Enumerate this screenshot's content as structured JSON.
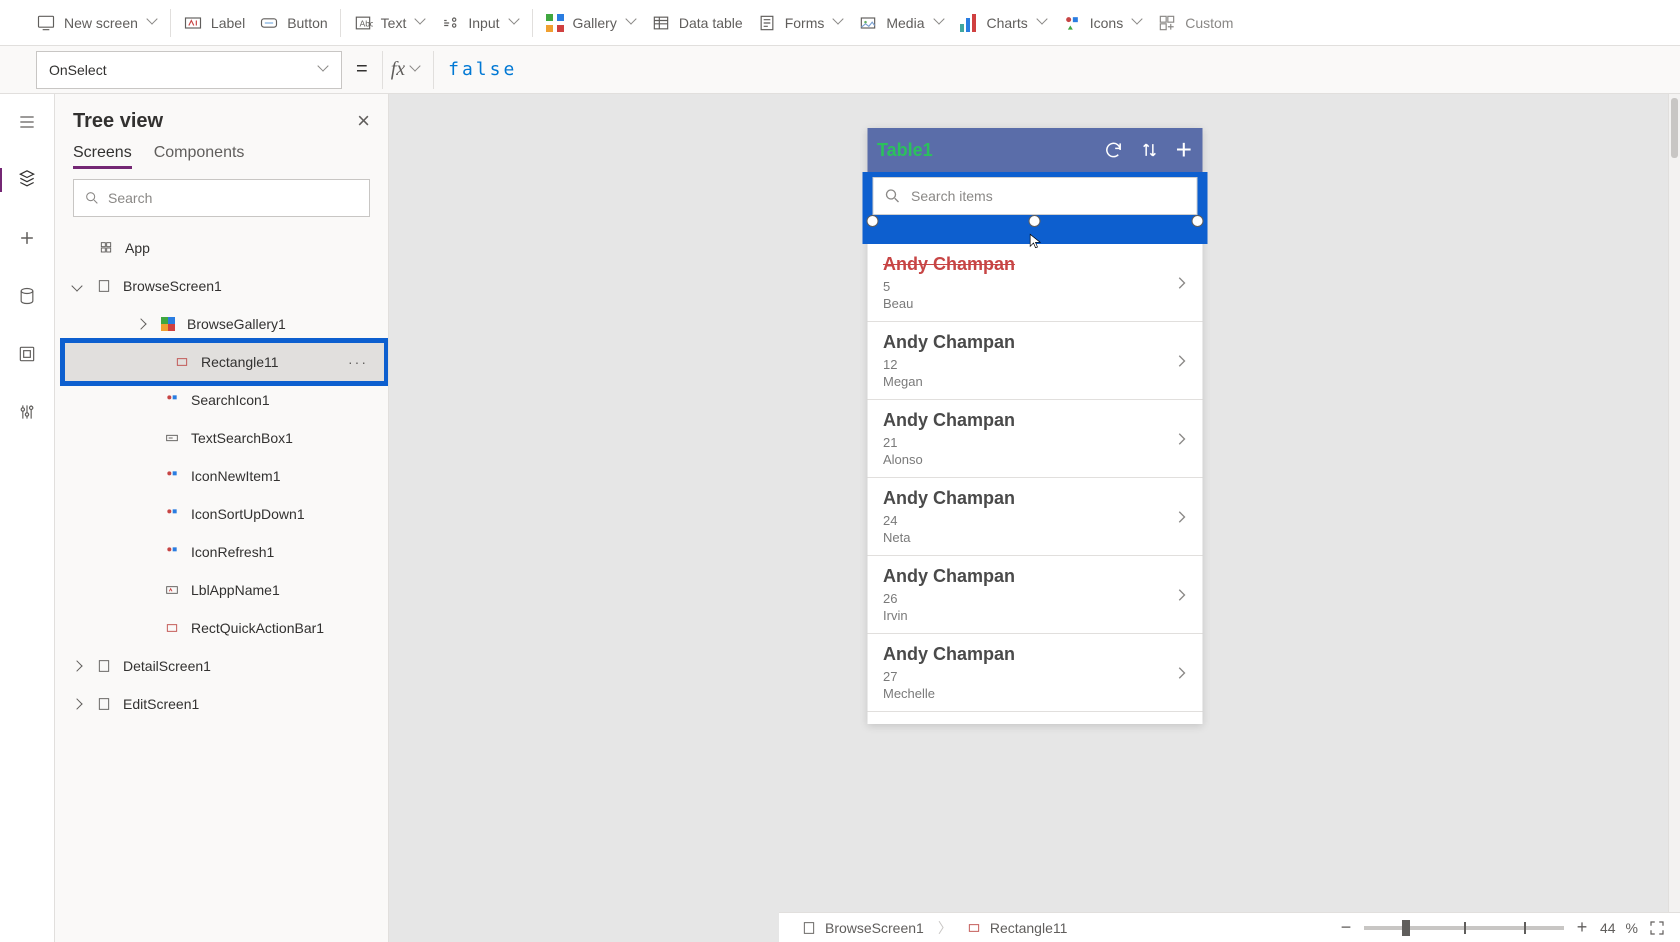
{
  "ribbon": {
    "new_screen": "New screen",
    "label": "Label",
    "button": "Button",
    "text": "Text",
    "input": "Input",
    "gallery": "Gallery",
    "data_table": "Data table",
    "forms": "Forms",
    "media": "Media",
    "charts": "Charts",
    "icons": "Icons",
    "custom": "Custom"
  },
  "formula": {
    "property": "OnSelect",
    "value": "false"
  },
  "tree": {
    "title": "Tree view",
    "tab_screens": "Screens",
    "tab_components": "Components",
    "search_placeholder": "Search",
    "app": "App",
    "browse_screen": "BrowseScreen1",
    "browse_gallery": "BrowseGallery1",
    "rectangle11": "Rectangle11",
    "search_icon1": "SearchIcon1",
    "text_search_box1": "TextSearchBox1",
    "icon_new_item1": "IconNewItem1",
    "icon_sort1": "IconSortUpDown1",
    "icon_refresh1": "IconRefresh1",
    "lbl_appname1": "LblAppName1",
    "rect_quick_action_bar1": "RectQuickActionBar1",
    "detail_screen": "DetailScreen1",
    "edit_screen": "EditScreen1"
  },
  "app_preview": {
    "title": "Table1",
    "search_placeholder": "Search items",
    "items": [
      {
        "name": "Andy Champan",
        "id": "5",
        "sub": "Beau"
      },
      {
        "name": "Andy Champan",
        "id": "12",
        "sub": "Megan"
      },
      {
        "name": "Andy Champan",
        "id": "21",
        "sub": "Alonso"
      },
      {
        "name": "Andy Champan",
        "id": "24",
        "sub": "Neta"
      },
      {
        "name": "Andy Champan",
        "id": "26",
        "sub": "Irvin"
      },
      {
        "name": "Andy Champan",
        "id": "27",
        "sub": "Mechelle"
      }
    ]
  },
  "status": {
    "crumb1": "BrowseScreen1",
    "crumb2": "Rectangle11",
    "zoom": "44",
    "zoom_unit": "%"
  }
}
